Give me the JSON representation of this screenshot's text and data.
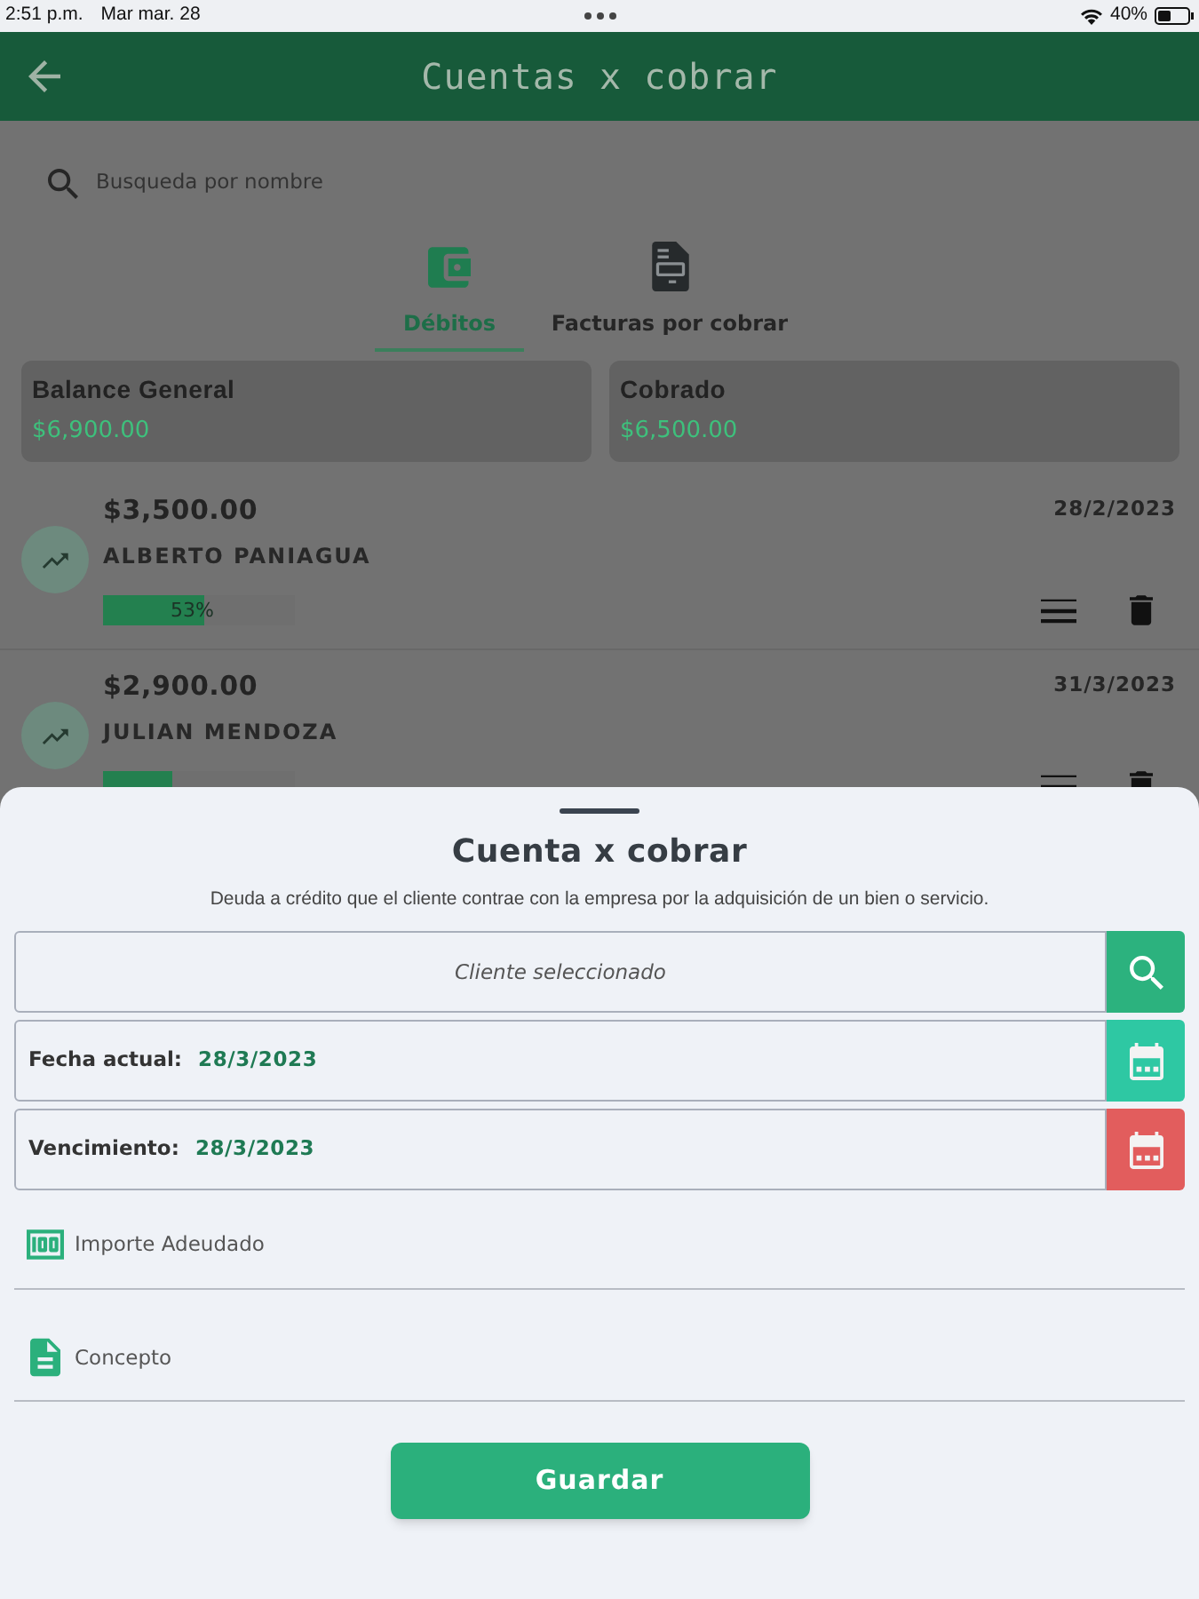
{
  "status_bar": {
    "time": "2:51 p.m.",
    "date": "Mar mar. 28",
    "battery": "40%"
  },
  "app_bar": {
    "title": "Cuentas x cobrar"
  },
  "search": {
    "placeholder": "Busqueda por nombre"
  },
  "tabs": [
    {
      "label": "Débitos",
      "kind": "wallet",
      "selected": true
    },
    {
      "label": "Facturas por cobrar",
      "kind": "invoice",
      "selected": false
    }
  ],
  "summary_cards": [
    {
      "title": "Balance General",
      "amount": "$6,900.00"
    },
    {
      "title": "Cobrado",
      "amount": "$6,500.00"
    }
  ],
  "debts": [
    {
      "amount": "$3,500.00",
      "date": "28/2/2023",
      "client": "ALBERTO PANIAGUA",
      "level": 0.53,
      "percent": "53%"
    },
    {
      "amount": "$2,900.00",
      "date": "31/3/2023",
      "client": "JULIAN MENDOZA",
      "level": 0.36
    }
  ],
  "sheet": {
    "title": "Cuenta x cobrar",
    "description": "Deuda a crédito que el cliente contrae con la empresa por la adquisición de un bien o servicio.",
    "client_field": {
      "placeholder": "Cliente seleccionado"
    },
    "date_rows": [
      {
        "label": "Fecha actual:",
        "value": "28/3/2023",
        "color": "#2ec8a3"
      },
      {
        "label": "Vencimiento:",
        "value": "28/3/2023",
        "color": "#e25d5d"
      }
    ],
    "inputs": [
      {
        "kind": "amount",
        "placeholder": "Importe Adeudado"
      },
      {
        "kind": "text",
        "placeholder": "Concepto"
      }
    ],
    "save_button": "Guardar"
  }
}
